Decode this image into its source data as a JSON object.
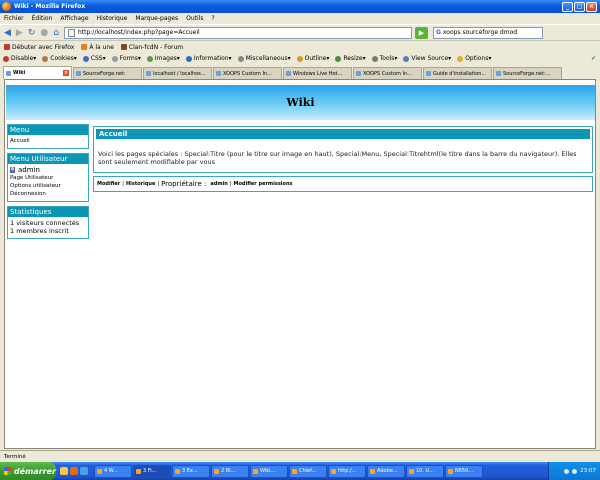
{
  "window": {
    "title": "Wiki - Mozilla Firefox",
    "controls": [
      "_",
      "□",
      "×"
    ]
  },
  "menu": [
    "Fichier",
    "Édition",
    "Affichage",
    "Historique",
    "Marque-pages",
    "Outils",
    "?"
  ],
  "nav": {
    "url": "http://localhost/index.php?page=Accueil",
    "search_value": "xoops sourceforge dmod",
    "search_engine": "G"
  },
  "bookmarks": [
    "Débuter avec Firefox",
    "À la une",
    "Clan-fcdN - Forum"
  ],
  "webdev_toolbar": [
    "Disable▾",
    "Cookies▾",
    "CSS▾",
    "Forms▾",
    "Images▾",
    "Information▾",
    "Miscellaneous▾",
    "Outline▾",
    "Resize▾",
    "Tools▾",
    "View Source▾",
    "Options▾"
  ],
  "tabs": [
    {
      "label": "Wiki",
      "active": true
    },
    {
      "label": "SourceForge.net:",
      "active": false
    },
    {
      "label": "localhost / localhos...",
      "active": false
    },
    {
      "label": "XOOPS Custom In...",
      "active": false
    },
    {
      "label": "Windows Live Hot...",
      "active": false
    },
    {
      "label": "XOOPS Custom In...",
      "active": false
    },
    {
      "label": "Guide d'installation...",
      "active": false
    },
    {
      "label": "SourceForge.net:...",
      "active": false
    }
  ],
  "page": {
    "banner": "Wiki",
    "menu_block": {
      "title": "Menu",
      "items": [
        "Accueil"
      ]
    },
    "user_block": {
      "title": "Menu Utilisateur",
      "username": "admin",
      "items": [
        "Page Utilisateur",
        "Options utilisateur",
        "Déconnexion"
      ]
    },
    "stats_block": {
      "title": "Statistiques",
      "lines": [
        "1 visiteurs connectés",
        "1 membres inscrit"
      ]
    },
    "article": {
      "title": "Accueil",
      "text": "Voici les pages spéciales : Special:Titre (pour le titre sur image en haut), Special:Menu, Special:Titrehtml(le titre dans la barre du navigateur). Elles sont seulement modifiable par vous"
    },
    "actions": {
      "edit": "Modifier",
      "history": "Historique",
      "owner_label": "Propriétaire :",
      "owner": "admin",
      "permissions": "Modifier permissions"
    }
  },
  "status_text": "Terminé",
  "taskbar": {
    "start": "démarrer",
    "tasks": [
      "4 W...",
      "3 Fi...",
      "3 Ex...",
      "2 Bl...",
      "Wiki...",
      "Chief...",
      "http:/...",
      "Adobe...",
      "10. U...",
      "N650..."
    ],
    "clock": "23:07"
  }
}
